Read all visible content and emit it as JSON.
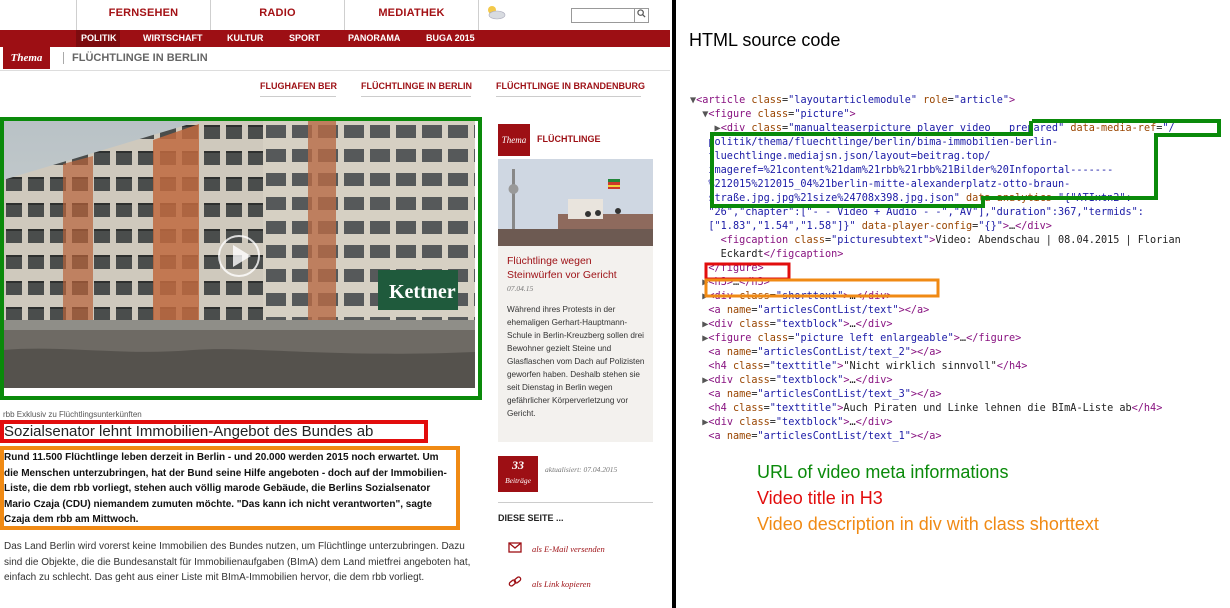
{
  "site": {
    "nav_top": [
      "FERNSEHEN",
      "RADIO",
      "MEDIATHEK"
    ],
    "search": {
      "placeholder": "",
      "button_icon": "search-icon"
    },
    "nav_red": [
      "POLITIK",
      "WIRTSCHAFT",
      "KULTUR",
      "SPORT",
      "PANORAMA",
      "BUGA 2015"
    ],
    "thema_badge": "Thema",
    "thema_title": "FLÜCHTLINGE IN BERLIN",
    "subnav": [
      "FLUGHAFEN BER",
      "FLÜCHTLINGE IN BERLIN",
      "FLÜCHTLINGE IN BRANDENBURG"
    ],
    "main_picture": {
      "building_sign": "Kettner",
      "caption_small": "rbb Exklusiv zu Flüchtlingsunterkünften"
    },
    "h3_title": "Sozialsenator lehnt Immobilien-Angebot des Bundes ab",
    "lead_text": "Rund 11.500 Flüchtlinge leben derzeit in Berlin - und 20.000 werden 2015 noch erwartet. Um die Menschen unterzubringen, hat der Bund seine Hilfe angeboten - doch auf der Immobilien-Liste, die dem rbb vorliegt, stehen auch völlig marode Gebäude, die Berlins Sozialsenator Mario Czaja (CDU) niemandem zumuten möchte. \"Das kann ich nicht verantworten\", sagte Czaja dem rbb am Mittwoch.",
    "body_text": "Das Land Berlin wird vorerst keine Immobilien des Bundes nutzen, um Flüchtlinge unterzubringen. Dazu sind die Objekte, die die Bundesanstalt für Immobilienaufgaben (BImA) dem Land mietfrei angeboten hat, einfach zu schlecht. Das geht aus einer Liste mit BImA-Immobilien hervor, die dem rbb vorliegt.",
    "right_column": {
      "badge": "Thema",
      "topic": "FLÜCHTLINGE",
      "headline": "Flüchtlinge wegen Steinwürfen vor Gericht",
      "date": "07.04.15",
      "body": "Während ihres Protests in der ehemaligen Gerhart-Hauptmann-Schule in Berlin-Kreuzberg sollen drei Bewohner gezielt Steine und Glasflaschen vom Dach auf Polizisten geworfen haben. Deshalb stehen sie seit Dienstag in Berlin wegen gefährlicher Körperverletzung vor Gericht.",
      "comment_count": "33",
      "comment_label": "Beiträge",
      "updated": "aktualisiert: 07.04.2015",
      "share_heading": "DIESE SEITE ...",
      "share_email": "als E-Mail versenden",
      "share_link": "als Link kopieren"
    }
  },
  "source_panel": {
    "title": "HTML source code",
    "legend": [
      {
        "text": "URL of video meta informations",
        "color": "#0a8a0a"
      },
      {
        "text": "Video title in H3",
        "color": "#e20d0d"
      },
      {
        "text": "Video description in div with class shorttext",
        "color": "#f08a14"
      }
    ]
  },
  "colors": {
    "brand_red": "#9d0f14",
    "highlight_green": "#0a8a0a",
    "highlight_red": "#e20d0d",
    "highlight_orange": "#f08a14"
  }
}
